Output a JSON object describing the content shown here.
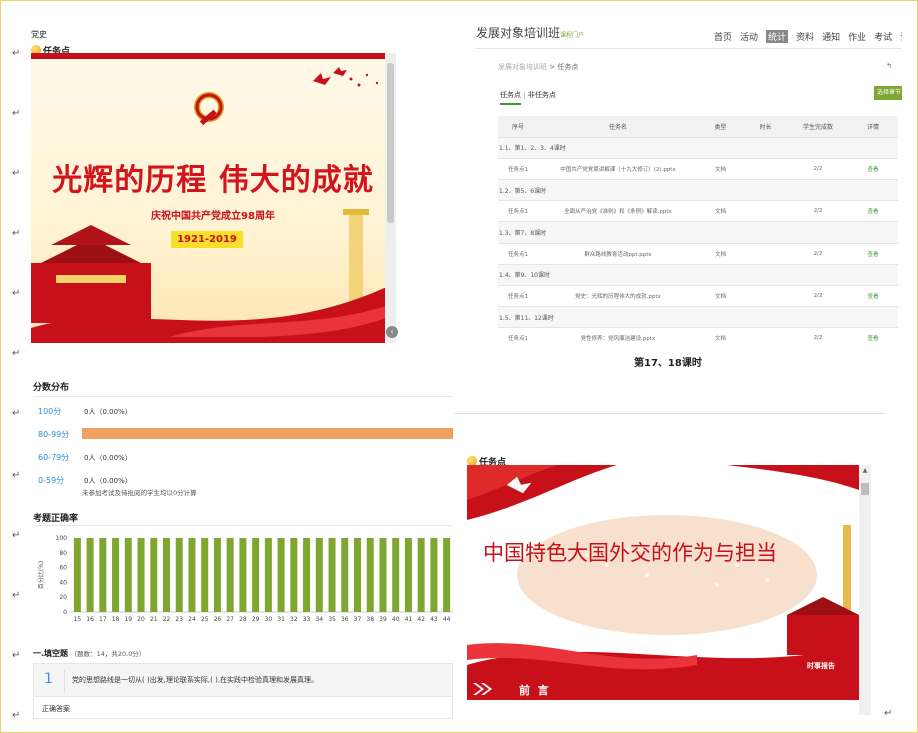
{
  "top_label": "党史",
  "task_point": "任务点",
  "slide1": {
    "title": "光辉的历程  伟大的成就",
    "subtitle": "庆祝中国共产党成立98周年",
    "years": "1921-2019"
  },
  "course": {
    "title": "发展对象培训班",
    "portal": "课程门户",
    "nav": [
      "首页",
      "活动",
      "统计",
      "资料",
      "通知",
      "作业",
      "考试",
      "讨论"
    ],
    "active_nav": "统计",
    "breadcrumb_root": "发展对象培训班",
    "breadcrumb_sep": ">",
    "breadcrumb_current": "任务点",
    "tab_task": "任务点",
    "tab_sep": "|",
    "tab_nontask": "非任务点",
    "select_btn": "选择章节",
    "headers": [
      "序号",
      "任务名",
      "类型",
      "时长",
      "学生完成数",
      "详情"
    ],
    "groups": [
      {
        "group": "1.1、第1、2、3、4课时",
        "row": [
          "任务点1",
          "中国共产党党章讲解课（十九大修订）(2).pptx",
          "文档",
          "",
          "2/2",
          "查看"
        ]
      },
      {
        "group": "1.2、第5、6课时",
        "row": [
          "任务点1",
          "全面从严治党《准则》和《条例》解读.pptx",
          "文档",
          "",
          "2/2",
          "查看"
        ]
      },
      {
        "group": "1.3、第7、8课时",
        "row": [
          "任务点1",
          "群众路线教育活动ppt.pptx",
          "文档",
          "",
          "2/2",
          "查看"
        ]
      },
      {
        "group": "1.4、第9、10课时",
        "row": [
          "任务点1",
          "党史：光辉的历程伟大的成就.pptx",
          "文档",
          "",
          "2/2",
          "查看"
        ]
      },
      {
        "group": "1.5、第11、12课时",
        "row": [
          "任务点1",
          "党性修养：党风廉洁建设.pptx",
          "文档",
          "",
          "2/2",
          "查看"
        ]
      }
    ]
  },
  "caption_1718": "第17、18课时",
  "score": {
    "title": "分数分布",
    "bands": [
      {
        "label": "100分",
        "value": "0人（0.00%）",
        "fraction": 0
      },
      {
        "label": "80-99分",
        "value": "",
        "fraction": 1
      },
      {
        "label": "60-79分",
        "value": "0人（0.00%）",
        "fraction": 0
      },
      {
        "label": "0-59分",
        "value": "0人（0.00%）",
        "fraction": 0
      }
    ],
    "note": "未参加考试及待批阅的学生均以0分计算",
    "bar_color": "#f0a060"
  },
  "accuracy": {
    "title": "考题正确率",
    "bar_color": "#7ea630"
  },
  "chart_data": {
    "type": "bar",
    "title": "考题正确率",
    "ylabel": "百分比(%)",
    "ylim": [
      0,
      100
    ],
    "yticks": [
      0,
      20,
      40,
      60,
      80,
      100
    ],
    "categories": [
      "15",
      "16",
      "17",
      "18",
      "19",
      "20",
      "21",
      "22",
      "23",
      "24",
      "25",
      "26",
      "27",
      "28",
      "29",
      "30",
      "31",
      "32",
      "33",
      "34",
      "35",
      "36",
      "37",
      "38",
      "39",
      "40",
      "41",
      "42",
      "43",
      "44"
    ],
    "values": [
      100,
      100,
      100,
      100,
      100,
      100,
      100,
      100,
      100,
      100,
      100,
      100,
      100,
      100,
      100,
      100,
      100,
      100,
      100,
      100,
      100,
      100,
      100,
      100,
      100,
      100,
      100,
      100,
      100,
      100
    ]
  },
  "quiz": {
    "section_title": "一.填空题",
    "section_meta": "（题数：14，共20.0分）",
    "q_number": "1",
    "q_text": "党的思想路线是一切从( )出发,理论联系实际,( ),在实践中检验真理和发展真理。",
    "answer_label": "正确答案"
  },
  "slide2": {
    "title": "中国特色大国外交的作为与担当",
    "logo": "时事报告",
    "band": "前  言"
  },
  "return_mark": "↵"
}
